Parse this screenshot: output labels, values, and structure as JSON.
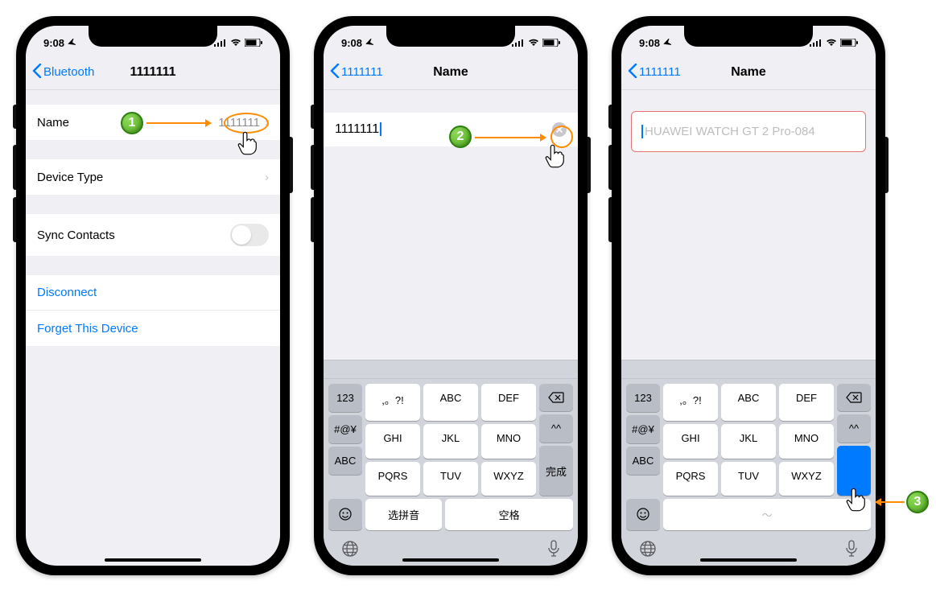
{
  "status": {
    "time": "9:08",
    "location_arrow": "↗"
  },
  "phone1": {
    "back_label": "Bluetooth",
    "title": "1111111",
    "rows": {
      "name_label": "Name",
      "name_value": "1111111",
      "device_type_label": "Device Type",
      "sync_contacts_label": "Sync Contacts",
      "disconnect_label": "Disconnect",
      "forget_label": "Forget This Device"
    }
  },
  "phone2": {
    "back_label": "1111111",
    "title": "Name",
    "input_value": "1111111"
  },
  "phone3": {
    "back_label": "1111111",
    "title": "Name",
    "placeholder": "HUAWEI WATCH GT 2 Pro-084"
  },
  "keyboard": {
    "left_col": [
      "123",
      "#@¥",
      "ABC"
    ],
    "grid": [
      ",。?!",
      "ABC",
      "DEF",
      "GHI",
      "JKL",
      "MNO",
      "PQRS",
      "TUV",
      "WXYZ"
    ],
    "right_caret": "^^",
    "done": "完成",
    "bottom_left_emoji": "☺",
    "bottom_mid1": "选拼音",
    "bottom_mid2": "空格",
    "bottom_mid_squiggle": "～"
  },
  "callouts": {
    "b1": "1",
    "b2": "2",
    "b3": "3"
  }
}
